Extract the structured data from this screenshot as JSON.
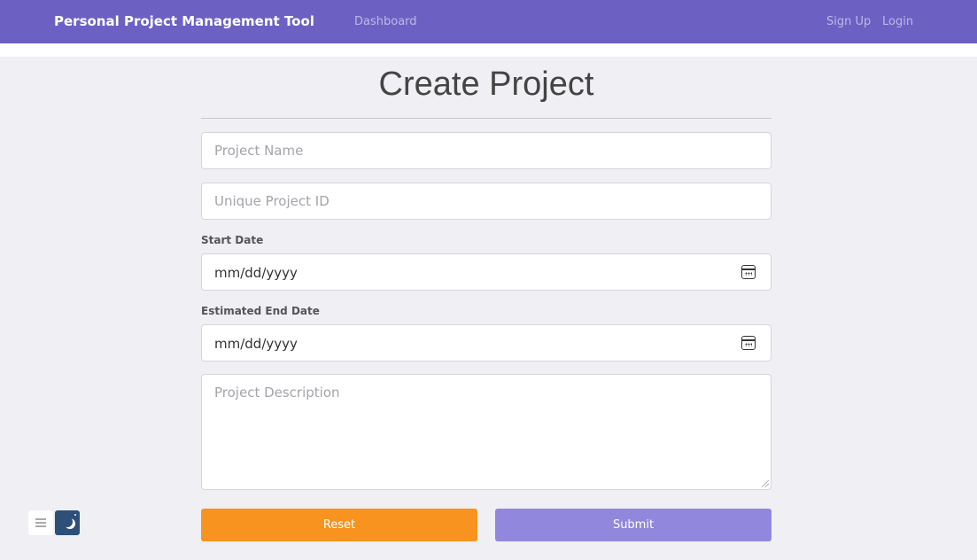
{
  "navbar": {
    "brand": "Personal Project Management Tool",
    "links": {
      "dashboard": "Dashboard",
      "signup": "Sign Up",
      "login": "Login"
    },
    "color": "#6c61c3"
  },
  "form": {
    "title": "Create Project",
    "project_name": {
      "placeholder": "Project Name",
      "value": ""
    },
    "project_id": {
      "placeholder": "Unique Project ID",
      "value": ""
    },
    "start_date": {
      "label": "Start Date",
      "value": "mm/dd/yyyy",
      "icon": "calendar-icon"
    },
    "end_date": {
      "label": "Estimated End Date",
      "value": "mm/dd/yyyy",
      "icon": "calendar-icon"
    },
    "description": {
      "placeholder": "Project Description",
      "value": ""
    },
    "buttons": {
      "reset": "Reset",
      "submit": "Submit"
    },
    "colors": {
      "reset": "#f7931e",
      "submit": "#9187dc"
    }
  },
  "widget": {
    "menu_icon": "hamburger-icon",
    "theme_icon": "moon-icon"
  }
}
